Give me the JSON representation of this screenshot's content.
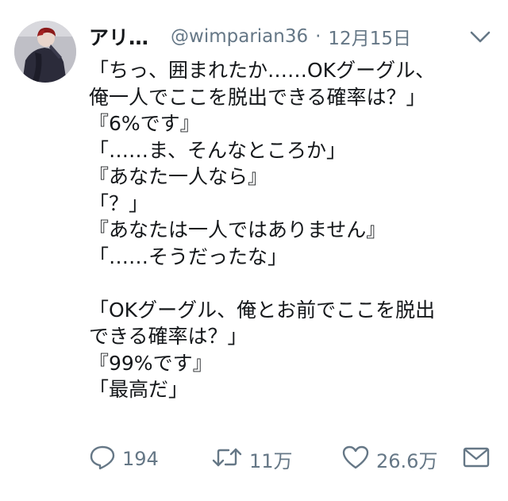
{
  "tweet": {
    "display_name": "アリ…",
    "handle": "@wimparian36",
    "separator": "·",
    "date": "12月15日",
    "body_lines": [
      "「ちっ、囲まれたか……OKグーグル、",
      "俺一人でここを脱出できる確率は？」",
      "『6%です』",
      "「……ま、そんなところか」",
      "『あなた一人なら』",
      "「？」",
      "『あなたは一人ではありません』",
      "「……そうだったな」",
      "",
      "「OKグーグル、俺とお前でここを脱出",
      "できる確率は？」",
      "『99%です』",
      "「最高だ」"
    ],
    "actions": {
      "reply_icon": "reply-icon",
      "reply_count": "194",
      "retweet_icon": "retweet-icon",
      "retweet_count": "11万",
      "like_icon": "heart-icon",
      "like_count": "26.6万",
      "dm_icon": "envelope-icon"
    },
    "menu_icon": "chevron-down-icon",
    "avatar_icon": "avatar"
  },
  "colors": {
    "text": "#14171a",
    "secondary": "#657786",
    "background": "#ffffff"
  }
}
